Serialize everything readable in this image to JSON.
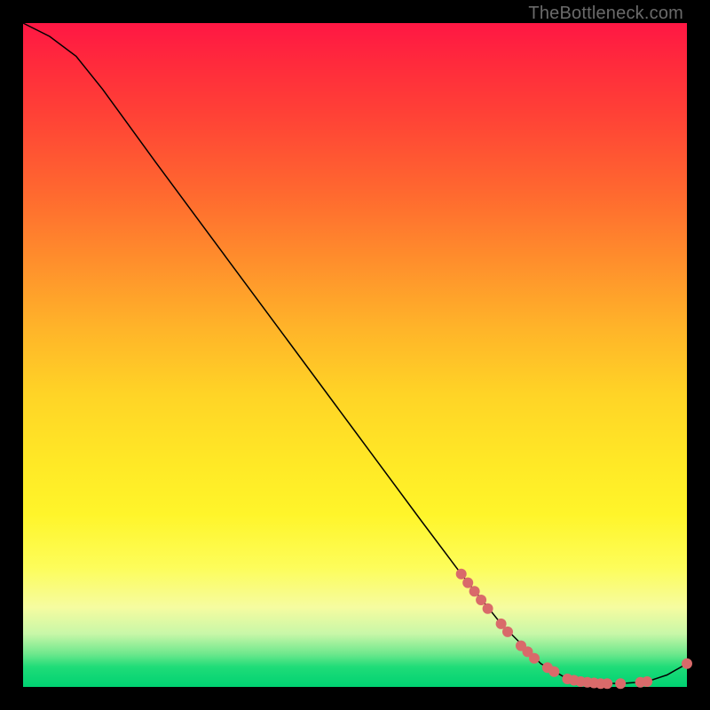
{
  "watermark": "TheBottleneck.com",
  "chart_data": {
    "type": "line",
    "title": "",
    "xlabel": "",
    "ylabel": "",
    "xlim": [
      0,
      100
    ],
    "ylim": [
      0,
      100
    ],
    "grid": false,
    "series": [
      {
        "name": "bottleneck-curve",
        "color": "#000000",
        "stroke_width": 1.5,
        "points": [
          {
            "x": 0,
            "y": 100
          },
          {
            "x": 4,
            "y": 98
          },
          {
            "x": 8,
            "y": 95
          },
          {
            "x": 12,
            "y": 90
          },
          {
            "x": 20,
            "y": 79
          },
          {
            "x": 30,
            "y": 65.5
          },
          {
            "x": 40,
            "y": 52
          },
          {
            "x": 50,
            "y": 38.5
          },
          {
            "x": 60,
            "y": 25
          },
          {
            "x": 66,
            "y": 17
          },
          {
            "x": 72,
            "y": 9.5
          },
          {
            "x": 78,
            "y": 3.5
          },
          {
            "x": 82,
            "y": 1.2
          },
          {
            "x": 86,
            "y": 0.6
          },
          {
            "x": 90,
            "y": 0.5
          },
          {
            "x": 94,
            "y": 0.8
          },
          {
            "x": 97,
            "y": 1.8
          },
          {
            "x": 100,
            "y": 3.5
          }
        ]
      },
      {
        "name": "highlight-markers",
        "type": "scatter",
        "color": "#d96a6a",
        "radius": 6,
        "points": [
          {
            "x": 66,
            "y": 17.0
          },
          {
            "x": 67,
            "y": 15.7
          },
          {
            "x": 68,
            "y": 14.4
          },
          {
            "x": 69,
            "y": 13.1
          },
          {
            "x": 70,
            "y": 11.8
          },
          {
            "x": 72,
            "y": 9.5
          },
          {
            "x": 73,
            "y": 8.3
          },
          {
            "x": 75,
            "y": 6.2
          },
          {
            "x": 76,
            "y": 5.3
          },
          {
            "x": 77,
            "y": 4.3
          },
          {
            "x": 79,
            "y": 2.9
          },
          {
            "x": 80,
            "y": 2.3
          },
          {
            "x": 82,
            "y": 1.2
          },
          {
            "x": 83,
            "y": 1.0
          },
          {
            "x": 84,
            "y": 0.8
          },
          {
            "x": 85,
            "y": 0.7
          },
          {
            "x": 86,
            "y": 0.6
          },
          {
            "x": 87,
            "y": 0.5
          },
          {
            "x": 88,
            "y": 0.5
          },
          {
            "x": 90,
            "y": 0.5
          },
          {
            "x": 93,
            "y": 0.7
          },
          {
            "x": 94,
            "y": 0.8
          },
          {
            "x": 100,
            "y": 3.5
          }
        ]
      }
    ]
  }
}
